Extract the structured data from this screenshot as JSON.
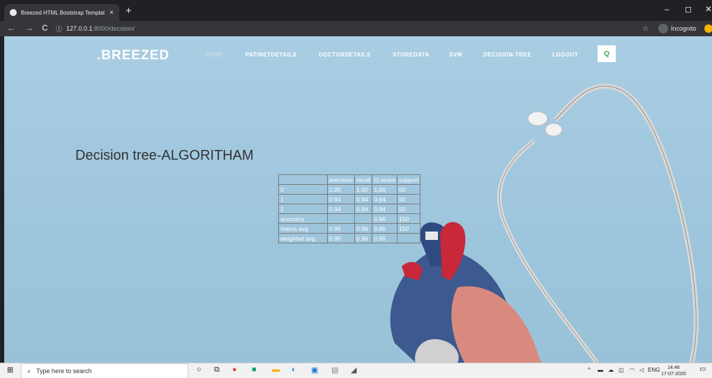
{
  "browser": {
    "tab_title": "Breezed HTML Bootstrap Templat",
    "tab_close": "×",
    "new_tab": "+",
    "back": "←",
    "forward": "→",
    "reload": "C",
    "url_host": "127.0.0.1",
    "url_path": ":8000/decision/",
    "star": "☆",
    "profile_label": "Incognito",
    "minimize": "–",
    "maximize": "◻",
    "close": "✕"
  },
  "site": {
    "brand": ".BREEZED",
    "menu": [
      {
        "label": "HOME"
      },
      {
        "label": "PATINETDETAILS"
      },
      {
        "label": "DOCTORDETAILS"
      },
      {
        "label": "STOREDATA"
      },
      {
        "label": "SVM"
      },
      {
        "label": "DECISION-TREE"
      },
      {
        "label": "LOGOUT"
      }
    ],
    "search_icon": "Q"
  },
  "main": {
    "heading": "Decision tree-ALGORITHAM",
    "report": {
      "headers": [
        "",
        "precision",
        "recall",
        "f1-score",
        "support"
      ],
      "rows": [
        [
          "0",
          "1.00",
          "1.00",
          "1.00",
          "50"
        ],
        [
          "1",
          "0.94",
          "0.94",
          "0.94",
          "50"
        ],
        [
          "2",
          "0.94",
          "0.94",
          "0.94",
          "50"
        ],
        [
          "accuracy",
          "",
          "",
          "0.96",
          "150"
        ],
        [
          "macro avg",
          "0.96",
          "0.96",
          "0.96",
          "150"
        ],
        [
          "weighted avg",
          "0.96",
          "0.96",
          "0.96",
          ""
        ]
      ]
    }
  },
  "taskbar": {
    "search_placeholder": "Type here to search",
    "language": "ENG",
    "time": "14:46",
    "date": "17-07-2020"
  }
}
